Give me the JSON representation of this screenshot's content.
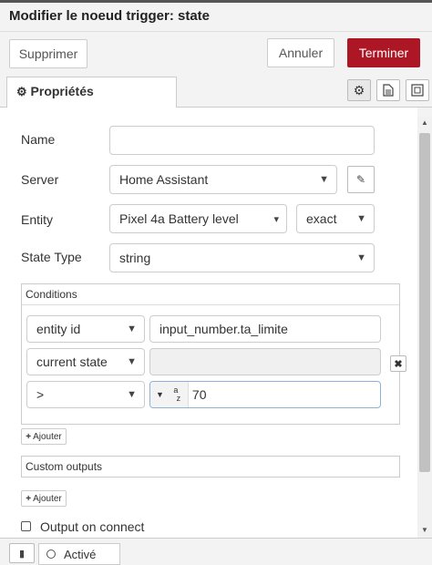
{
  "title": "Modifier le noeud trigger: state",
  "buttons": {
    "delete": "Supprimer",
    "cancel": "Annuler",
    "done": "Terminer"
  },
  "tab": {
    "label": "Propriétés"
  },
  "fields": {
    "name_label": "Name",
    "name_value": "",
    "server_label": "Server",
    "server_value": "Home Assistant",
    "entity_label": "Entity",
    "entity_value": "Pixel 4a Battery level",
    "entity_match": "exact",
    "state_type_label": "State Type",
    "state_type_value": "string"
  },
  "conditions": {
    "header": "Conditions",
    "rows": [
      {
        "property": "entity id",
        "value": "input_number.ta_limite"
      },
      {
        "property": "current state",
        "value": ""
      },
      {
        "property": ">",
        "type_indicator": "a z",
        "value": "70"
      }
    ],
    "add_label": "Ajouter"
  },
  "custom_outputs": {
    "header": "Custom outputs",
    "add_label": "Ajouter"
  },
  "output_on_connect": {
    "label": "Output on connect",
    "checked": false
  },
  "footer": {
    "status": "Activé"
  }
}
